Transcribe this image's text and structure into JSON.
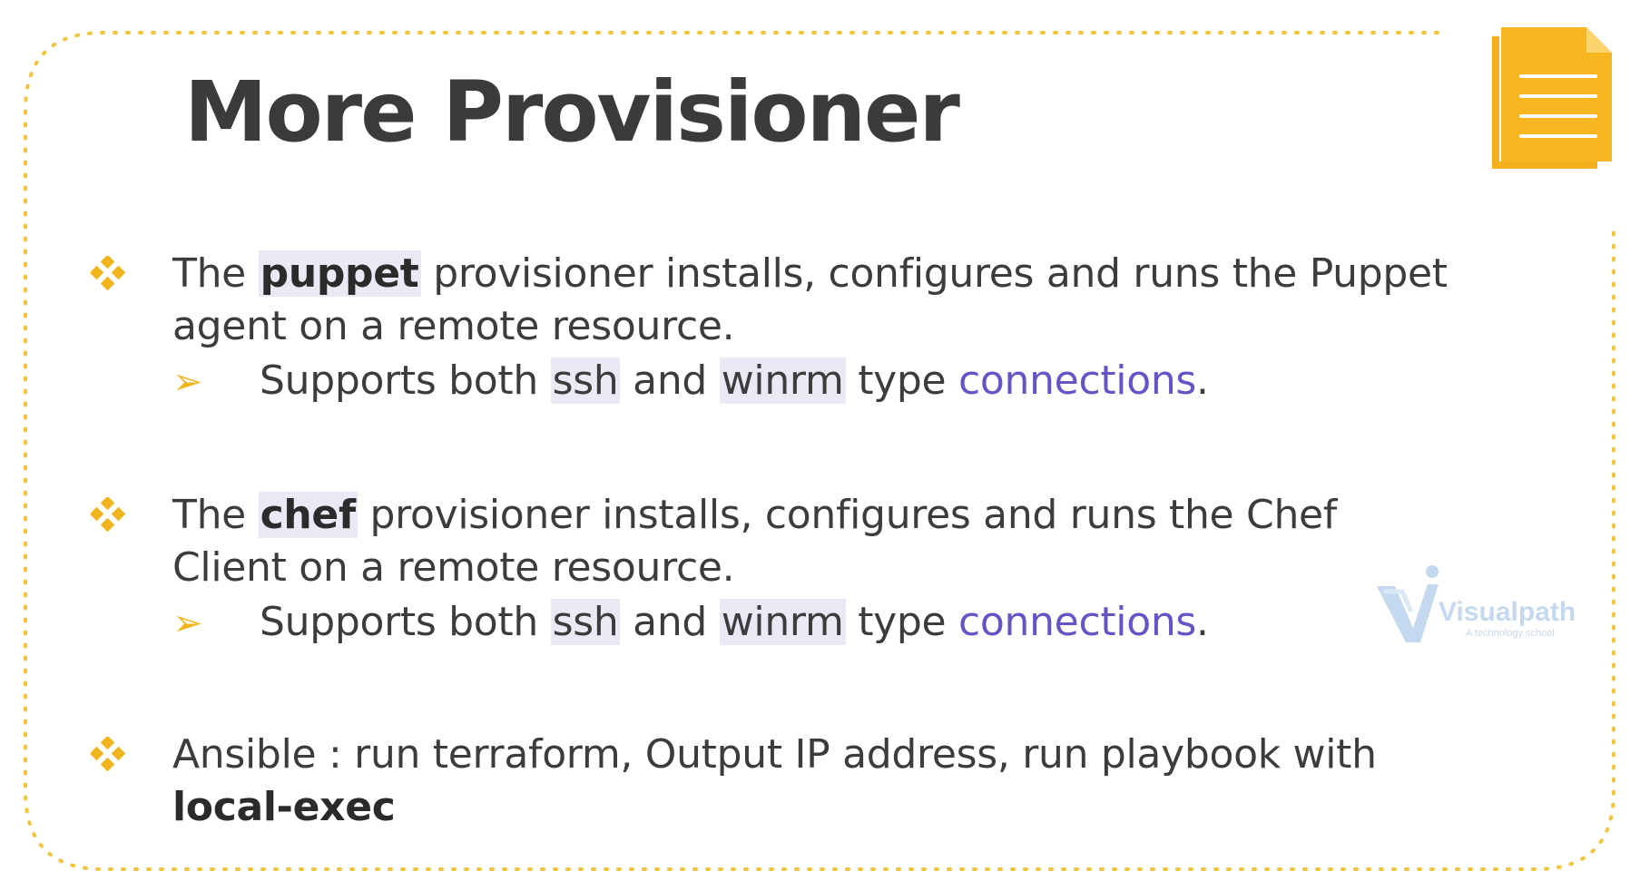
{
  "slide": {
    "title": "More Provisioner"
  },
  "bullets": [
    {
      "pre": "The ",
      "highlight": "puppet",
      "line1_rest": " provisioner installs, configures and runs the Puppet",
      "line2": "agent on a remote resource.",
      "sub": {
        "pre": "Supports both ",
        "ssh": "ssh",
        "and": " and ",
        "winrm": "winrm",
        "type": " type ",
        "link": "connections",
        "end": "."
      }
    },
    {
      "pre": "The ",
      "highlight": "chef",
      "line1_rest": " provisioner installs, configures and runs the Chef",
      "line2": "Client on a remote resource.",
      "sub": {
        "pre": "Supports both ",
        "ssh": "ssh",
        "and": " and ",
        "winrm": "winrm",
        "type": " type ",
        "link": "connections",
        "end": "."
      }
    },
    {
      "line1": "Ansible : run terraform, Output IP address, run playbook with",
      "line2": "local-exec"
    }
  ],
  "watermark": {
    "brand": "Visualpath",
    "tagline": "A technology school"
  },
  "colors": {
    "accent": "#f2b51e",
    "link": "#6553c7",
    "highlight": "#ece8f6",
    "text": "#3c3c3c"
  },
  "icons": {
    "bullet": "diamond-bullet-icon",
    "sub_bullet": "arrow-bullet-icon",
    "document": "document-icon"
  }
}
